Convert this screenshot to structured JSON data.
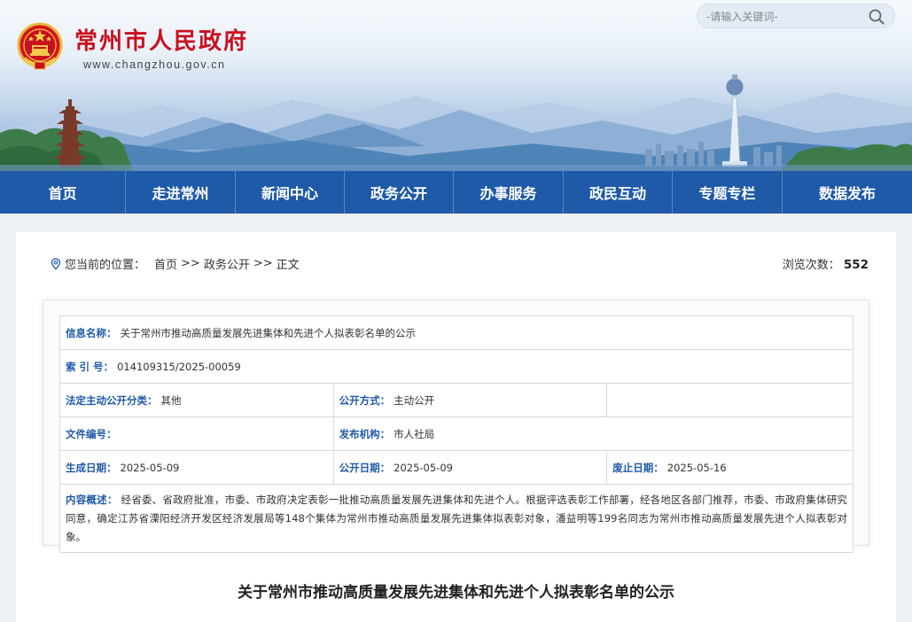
{
  "header": {
    "site_title": "常州市人民政府",
    "site_url": "www.changzhou.gov.cn",
    "search_placeholder": "-请输入关键词-"
  },
  "nav": {
    "items": [
      {
        "label": "首页"
      },
      {
        "label": "走进常州"
      },
      {
        "label": "新闻中心"
      },
      {
        "label": "政务公开"
      },
      {
        "label": "办事服务"
      },
      {
        "label": "政民互动"
      },
      {
        "label": "专题专栏"
      },
      {
        "label": "数据发布"
      }
    ]
  },
  "breadcrumb": {
    "prefix": "您当前的位置：",
    "items": [
      "首页",
      "政务公开",
      "正文"
    ],
    "separator": ">>"
  },
  "views": {
    "label": "浏览次数：",
    "count": "552"
  },
  "meta": {
    "info_name_label": "信息名称：",
    "info_name": "关于常州市推动高质量发展先进集体和先进个人拟表彰名单的公示",
    "index_label": "索 引 号：",
    "index": "014109315/2025-00059",
    "category_label": "法定主动公开分类：",
    "category": "其他",
    "method_label": "公开方式：",
    "method": "主动公开",
    "doc_no_label": "文件编号：",
    "doc_no": "",
    "publisher_label": "发布机构：",
    "publisher": "市人社局",
    "created_label": "生成日期：",
    "created": "2025-05-09",
    "published_label": "公开日期：",
    "published": "2025-05-09",
    "expiry_label": "废止日期：",
    "expiry": "2025-05-16",
    "summary_label": "内容概述：",
    "summary": "经省委、省政府批准，市委、市政府决定表彰一批推动高质量发展先进集体和先进个人。根据评选表彰工作部署，经各地区各部门推荐，市委、市政府集体研究同意，确定江苏省溧阳经济开发区经济发展局等148个集体为常州市推动高质量发展先进集体拟表彰对象，潘益明等199名同志为常州市推动高质量发展先进个人拟表彰对象。"
  },
  "article": {
    "title": "关于常州市推动高质量发展先进集体和先进个人拟表彰名单的公示"
  },
  "colors": {
    "nav_bg": "#1f5aa8",
    "title_red": "#c8101e",
    "label_blue": "#1f5aa8"
  },
  "icons": {
    "emblem": "national-emblem-icon",
    "search": "search-icon",
    "location": "location-icon"
  }
}
